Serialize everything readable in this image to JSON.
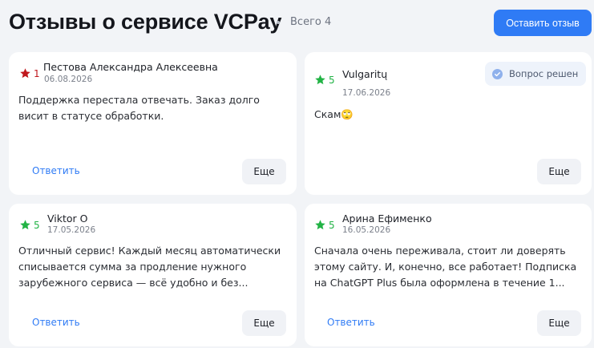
{
  "header": {
    "title": "Отзывы о сервисе VCPay",
    "total": "Всего 4",
    "leave_review": "Оставить отзыв"
  },
  "colors": {
    "accent": "#2f7bf5",
    "star_low": "#c0181d",
    "star_high": "#22b345",
    "background": "#f2f4f7"
  },
  "reviews": [
    {
      "rating": "1",
      "star_icon": "star-icon",
      "author": "Пестова Александра Алексеевна",
      "date": "06.08.2026",
      "text": "Поддержка перестала отвечать. Заказ долго висит в статусе обработки.",
      "reply": "Ответить",
      "more": "Еще"
    },
    {
      "rating": "5",
      "star_icon": "star-icon",
      "author": "Vulgaritų",
      "date": "17.06.2026",
      "badge": "Вопрос решен",
      "text": "Скам🙄",
      "more": "Еще"
    },
    {
      "rating": "5",
      "star_icon": "star-icon",
      "author": "Viktor O",
      "date": "17.05.2026",
      "text": "Отличный сервис! Каждый месяц автоматически списывается сумма за продление нужного зарубежного сервиса — всё удобно и без...",
      "reply": "Ответить",
      "more": "Еще"
    },
    {
      "rating": "5",
      "star_icon": "star-icon",
      "author": "Арина Ефименко",
      "date": "16.05.2026",
      "text": "Сначала очень переживала, стоит ли доверять этому сайту. И, конечно, все работает! Подписка на ChatGPT Plus была оформлена в течение 1...",
      "reply": "Ответить",
      "more": "Еще"
    }
  ]
}
